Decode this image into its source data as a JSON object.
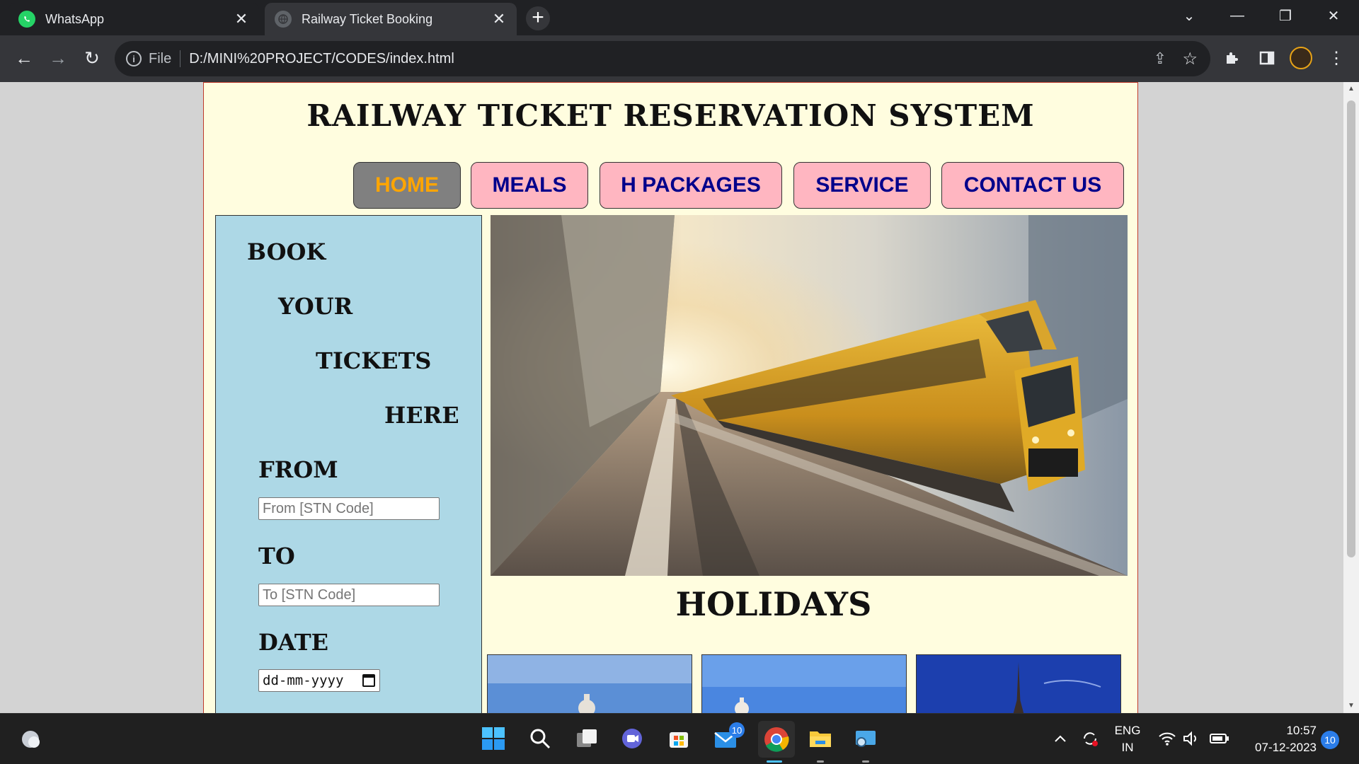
{
  "browser": {
    "tabs": [
      {
        "title": "WhatsApp",
        "active": false
      },
      {
        "title": "Railway Ticket Booking",
        "active": true
      }
    ],
    "address": {
      "scheme_label": "File",
      "url": "D:/MINI%20PROJECT/CODES/index.html"
    }
  },
  "site": {
    "title": "RAILWAY TICKET RESERVATION SYSTEM",
    "menu": [
      {
        "label": "HOME",
        "active": true
      },
      {
        "label": "MEALS",
        "active": false
      },
      {
        "label": "H PACKAGES",
        "active": false
      },
      {
        "label": "SERVICE",
        "active": false
      },
      {
        "label": "CONTACT US",
        "active": false
      }
    ],
    "booking": {
      "heading_words": [
        "BOOK",
        "YOUR",
        "TICKETS",
        "HERE"
      ],
      "from_label": "FROM",
      "from_placeholder": "From [STN Code]",
      "to_label": "TO",
      "to_placeholder": "To [STN Code]",
      "date_label": "DATE",
      "date_placeholder": "dd-mm-yyyy"
    },
    "holidays_heading": "HOLIDAYS"
  },
  "taskbar": {
    "mail_badge": "10",
    "language": {
      "line1": "ENG",
      "line2": "IN"
    },
    "time": "10:57",
    "date": "07-12-2023",
    "notifications": "10"
  },
  "colors": {
    "page_bg": "#fffddf",
    "sidebar_bg": "#add8e6",
    "menu_bg": "#ffb6c1",
    "menu_text": "#00008b",
    "menu_active_bg": "#808080",
    "menu_active_text": "#ffa500"
  }
}
